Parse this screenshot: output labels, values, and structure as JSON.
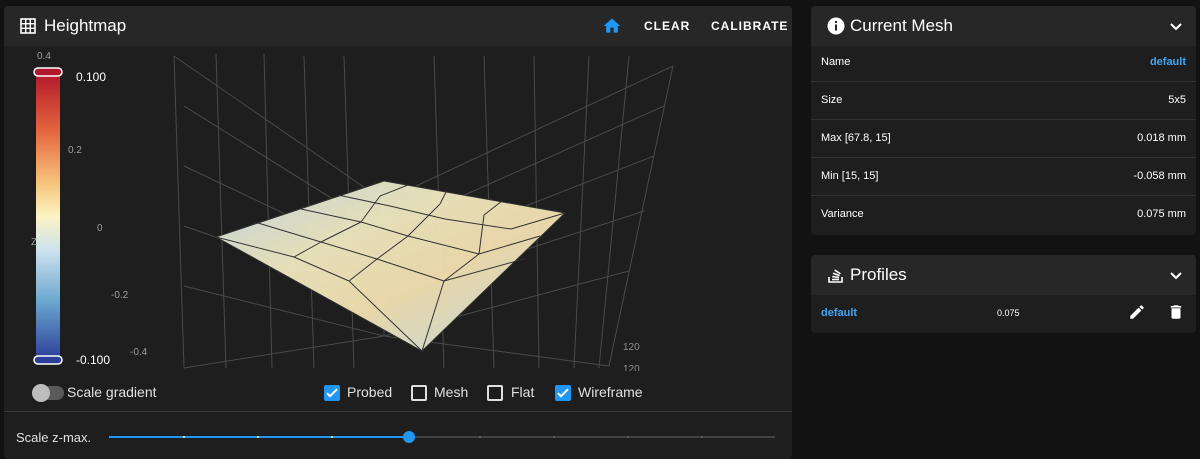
{
  "heightmap": {
    "title": "Heightmap",
    "title_icon": "grid-icon",
    "home_icon": "home-icon",
    "clear_label": "CLEAR",
    "calibrate_label": "CALIBRATE",
    "colorbar": {
      "max_label": "0.100",
      "min_label": "-0.100",
      "axis_ticks": [
        "0.4",
        "0.2",
        "0",
        "-0.2",
        "-0.4"
      ],
      "z_label": "Z",
      "colors": [
        "#b2182b",
        "#ef8a62",
        "#fddbc7",
        "#fdf4c6",
        "#d1e5f0",
        "#67a9cf",
        "#2b3f99"
      ]
    },
    "axis_ticks_3d": [
      "120",
      "120"
    ],
    "scale_gradient_label": "Scale gradient",
    "scale_gradient_on": false,
    "checkboxes": [
      {
        "label": "Probed",
        "checked": true
      },
      {
        "label": "Mesh",
        "checked": false
      },
      {
        "label": "Flat",
        "checked": false
      },
      {
        "label": "Wireframe",
        "checked": true
      }
    ],
    "zmax_label": "Scale z-max.",
    "zmax_fraction": 0.45,
    "zmax_steps": 9
  },
  "current_mesh": {
    "title": "Current Mesh",
    "icon": "info-icon",
    "rows": [
      {
        "key": "Name",
        "value": "default",
        "link": true
      },
      {
        "key": "Size",
        "value": "5x5",
        "link": false
      },
      {
        "key": "Max [67.8, 15]",
        "value": "0.018 mm",
        "link": false
      },
      {
        "key": "Min [15, 15]",
        "value": "-0.058 mm",
        "link": false
      },
      {
        "key": "Variance",
        "value": "0.075 mm",
        "link": false
      }
    ]
  },
  "profiles": {
    "title": "Profiles",
    "icon": "stack-icon",
    "items": [
      {
        "name": "default",
        "variance": "0.075",
        "edit_icon": "pencil-icon",
        "delete_icon": "trash-icon"
      }
    ]
  }
}
